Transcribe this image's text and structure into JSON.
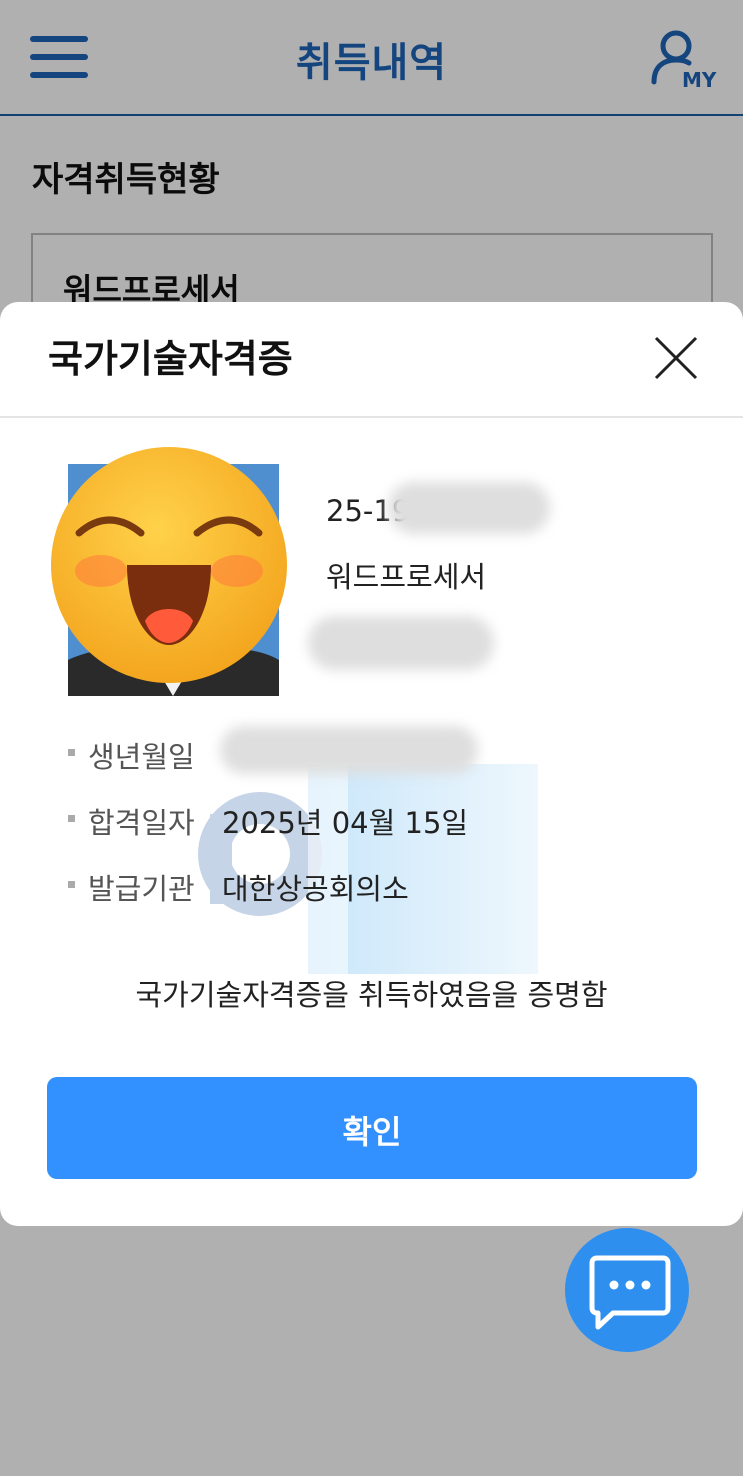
{
  "header": {
    "title": "취득내역",
    "my_label": "MY"
  },
  "page": {
    "section_title": "자격취득현황",
    "card_title": "워드프로세서"
  },
  "modal": {
    "title": "국가기술자격증",
    "cert_number": "25-19",
    "cert_name": "워드프로세서",
    "fields": [
      {
        "label": "생년월일",
        "value": ""
      },
      {
        "label": "합격일자",
        "value": "2025년 04월 15일"
      },
      {
        "label": "발급기관",
        "value": "대한상공회의소"
      }
    ],
    "statement": "국가기술자격증을 취득하였음을 증명함",
    "confirm_label": "확인"
  },
  "colors": {
    "accent": "#1f64b8",
    "button": "#3290ff",
    "fab": "#2f8fef"
  }
}
